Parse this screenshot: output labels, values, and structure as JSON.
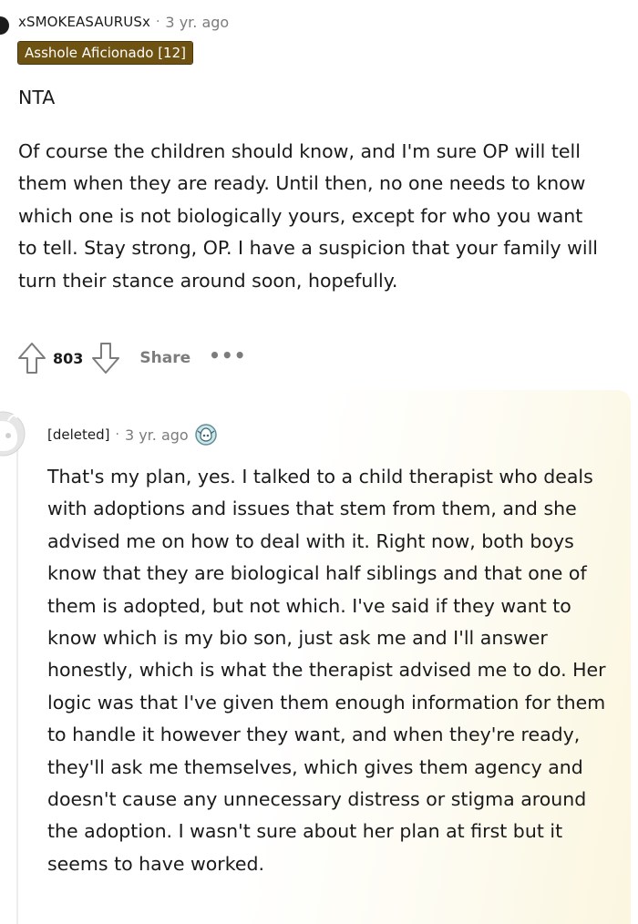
{
  "comment": {
    "username": "xSMOKEASAURUSx",
    "separator": "·",
    "timestamp": "3 yr. ago",
    "flair": "Asshole Aficionado [12]",
    "verdict": "NTA",
    "body": "Of course the children should know, and I'm sure OP will tell them when they are ready. Until then, no one needs to know which one is not biologically yours, except for who you want to tell. Stay strong, OP. I have a suspicion that your family will turn their stance around soon, hopefully.",
    "score": "803",
    "share_label": "Share",
    "more_label": "•••",
    "icons": {
      "upvote": "upvote-arrow-icon",
      "downvote": "downvote-arrow-icon",
      "more": "ellipsis-icon"
    }
  },
  "reply": {
    "username": "[deleted]",
    "separator": "·",
    "timestamp": "3 yr. ago",
    "avatar_icon": "default-avatar-icon",
    "award_icon": "award-icon",
    "body": "That's my plan, yes. I talked to a child therapist who deals with adoptions and issues that stem from them, and she advised me on how to deal with it. Right now, both boys know that they are biological half siblings and that one of them is adopted, but not which. I've said if they want to know which is my bio son, just ask me and I'll answer honestly, which is what the therapist advised me to do. Her logic was that I've given them enough information for them to handle it however they want, and when they're ready, they'll ask me themselves, which gives them agency and doesn't cause any unnecessary distress or stigma around the adoption. I wasn't sure about her plan at first but it seems to have worked."
  },
  "colors": {
    "flair_bg": "#6e5212",
    "muted_text": "#7c7c7c",
    "body_text": "#1a1a1b",
    "reply_highlight": "#fbf6df"
  }
}
